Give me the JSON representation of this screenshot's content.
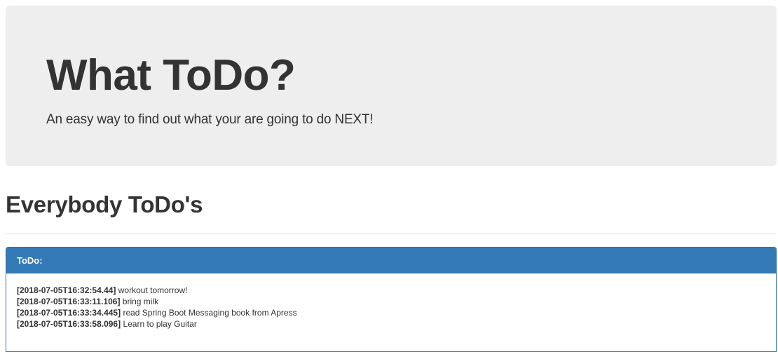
{
  "jumbotron": {
    "title": "What ToDo?",
    "subtitle": "An easy way to find out what your are going to do NEXT!"
  },
  "section": {
    "heading": "Everybody ToDo's"
  },
  "panel": {
    "title": "ToDo:",
    "items": [
      {
        "timestamp": "[2018-07-05T16:32:54.44]",
        "text": "workout tomorrow!"
      },
      {
        "timestamp": "[2018-07-05T16:33:11.106]",
        "text": "bring milk"
      },
      {
        "timestamp": "[2018-07-05T16:33:34.445]",
        "text": "read Spring Boot Messaging book from Apress"
      },
      {
        "timestamp": "[2018-07-05T16:33:58.096]",
        "text": "Learn to play Guitar"
      }
    ]
  },
  "colors": {
    "jumbotron_bg": "#eeeeee",
    "panel_primary": "#337ab7",
    "text": "#333333"
  }
}
